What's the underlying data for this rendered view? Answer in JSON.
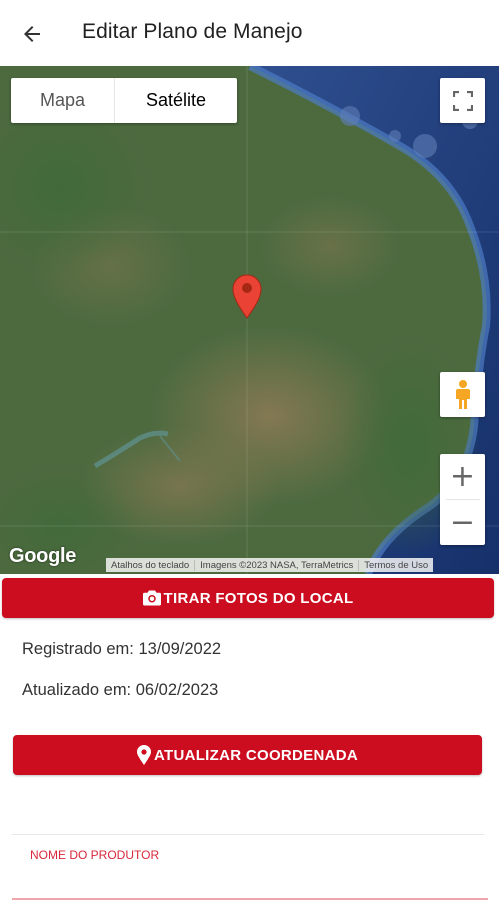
{
  "header": {
    "title": "Editar Plano de Manejo"
  },
  "map": {
    "type_options": [
      "Mapa",
      "Satélite"
    ],
    "selected_type": "Satélite",
    "google_logo": "Google",
    "attribution": [
      "Atalhos do teclado",
      "Imagens ©2023 NASA, TerraMetrics",
      "Termos de Uso"
    ],
    "zoom_in": "+",
    "zoom_out": "−"
  },
  "actions": {
    "photo_label": "TIRAR FOTOS DO LOCAL",
    "coord_label": "ATUALIZAR COORDENADA"
  },
  "info": {
    "registered": "Registrado em: 13/09/2022",
    "updated": "Atualizado em: 06/02/2023"
  },
  "form": {
    "producer_label": "NOME DO PRODUTOR",
    "producer_value": ""
  },
  "colors": {
    "accent": "#cc0d1f",
    "label": "#d8283a"
  }
}
